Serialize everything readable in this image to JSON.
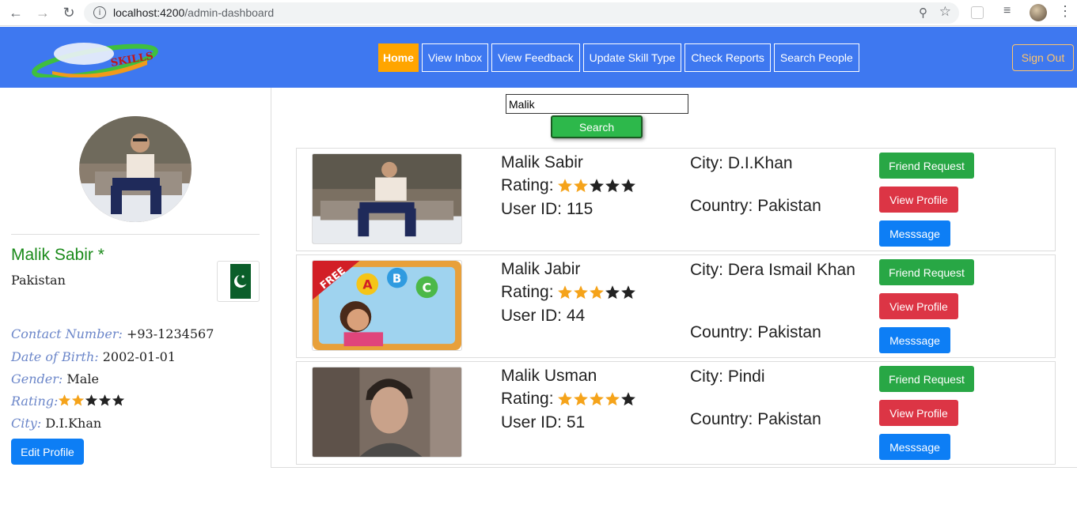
{
  "browser": {
    "url_host": "localhost:4200",
    "url_path": "/admin-dashboard"
  },
  "navbar": {
    "logo_text": "SKILLS",
    "links": [
      {
        "label": "Home",
        "active": true
      },
      {
        "label": "View Inbox",
        "active": false
      },
      {
        "label": "View Feedback",
        "active": false
      },
      {
        "label": "Update Skill Type",
        "active": false
      },
      {
        "label": "Check Reports",
        "active": false
      },
      {
        "label": "Search People",
        "active": false
      }
    ],
    "signout_label": "Sign Out",
    "bg_color": "#3e78f0",
    "active_color": "#ffa500"
  },
  "profile": {
    "name": "Malik Sabir *",
    "country": "Pakistan",
    "contact_label": "Contact Number:",
    "contact_value": "+93-1234567",
    "dob_label": "Date of Birth:",
    "dob_value": "2002-01-01",
    "gender_label": "Gender:",
    "gender_value": "Male",
    "rating_label": "Rating:",
    "rating": 2,
    "rating_max": 5,
    "city_label": "City:",
    "city_value": "D.I.Khan",
    "edit_label": "Edit Profile"
  },
  "search": {
    "value": "Malik",
    "button_label": "Search"
  },
  "results": [
    {
      "name": "Malik Sabir",
      "rating_label": "Rating:",
      "rating": 2,
      "uid_label": "User ID: 115",
      "city": "City: D.I.Khan",
      "country": "Country: Pakistan",
      "friend": "Friend Request",
      "view": "View Profile",
      "msg": "Messsage"
    },
    {
      "name": "Malik Jabir",
      "rating_label": "Rating:",
      "rating": 3,
      "uid_label": "User ID: 44",
      "city": "City: Dera Ismail Khan",
      "country": "Country: Pakistan",
      "friend": "Friend Request",
      "view": "View Profile",
      "msg": "Messsage"
    },
    {
      "name": "Malik Usman",
      "rating_label": "Rating:",
      "rating": 4,
      "uid_label": "User ID: 51",
      "city": "City: Pindi",
      "country": "Country: Pakistan",
      "friend": "Friend Request",
      "view": "View Profile",
      "msg": "Messsage"
    }
  ],
  "colors": {
    "star_on": "#f5a31a",
    "star_off": "#222222",
    "success": "#28a745",
    "danger": "#dc3545",
    "primary": "#0d7ef5"
  }
}
